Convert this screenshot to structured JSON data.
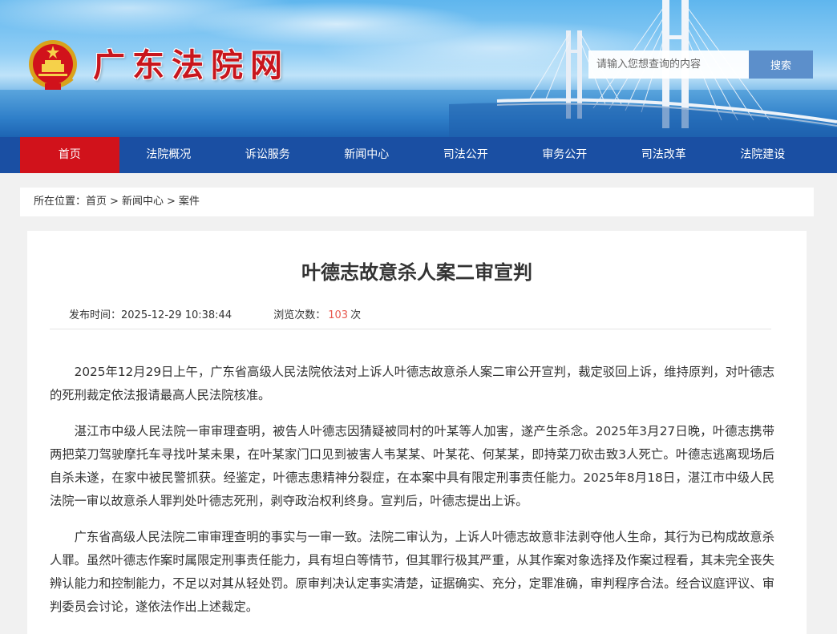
{
  "header": {
    "site_title": "广东法院网",
    "search_placeholder": "请输入您想查询的内容",
    "search_button": "搜索"
  },
  "nav": {
    "items": [
      {
        "label": "首页",
        "active": true
      },
      {
        "label": "法院概况"
      },
      {
        "label": "诉讼服务"
      },
      {
        "label": "新闻中心"
      },
      {
        "label": "司法公开"
      },
      {
        "label": "审务公开"
      },
      {
        "label": "司法改革"
      },
      {
        "label": "法院建设"
      }
    ]
  },
  "breadcrumb": {
    "prefix": "所在位置：",
    "items": [
      "首页",
      "新闻中心",
      "案件"
    ],
    "separator": ">"
  },
  "article": {
    "title": "叶德志故意杀人案二审宣判",
    "publish_label": "发布时间：",
    "publish_time": "2025-12-29 10:38:44",
    "views_label": "浏览次数：",
    "views_count": "103",
    "views_unit": "次",
    "paragraphs": [
      "2025年12月29日上午，广东省高级人民法院依法对上诉人叶德志故意杀人案二审公开宣判，裁定驳回上诉，维持原判，对叶德志的死刑裁定依法报请最高人民法院核准。",
      "湛江市中级人民法院一审审理查明，被告人叶德志因猜疑被同村的叶某等人加害，遂产生杀念。2025年3月27日晚，叶德志携带两把菜刀驾驶摩托车寻找叶某未果，在叶某家门口见到被害人韦某某、叶某花、何某某，即持菜刀砍击致3人死亡。叶德志逃离现场后自杀未遂，在家中被民警抓获。经鉴定，叶德志患精神分裂症，在本案中具有限定刑事责任能力。2025年8月18日，湛江市中级人民法院一审以故意杀人罪判处叶德志死刑，剥夺政治权利终身。宣判后，叶德志提出上诉。",
      "广东省高级人民法院二审审理查明的事实与一审一致。法院二审认为，上诉人叶德志故意非法剥夺他人生命，其行为已构成故意杀人罪。虽然叶德志作案时属限定刑事责任能力，具有坦白等情节，但其罪行极其严重，从其作案对象选择及作案过程看，其未完全丧失辨认能力和控制能力，不足以对其从轻处罚。原审判决认定事实清楚，证据确实、充分，定罪准确，审判程序合法。经合议庭评议、审判委员会讨论，遂依法作出上述裁定。"
    ]
  },
  "colors": {
    "nav_bg": "#1a4fa3",
    "nav_active": "#d1121b",
    "title_red": "#c8161d",
    "views_count": "#e8594f",
    "search_button": "#5c8fcb"
  }
}
